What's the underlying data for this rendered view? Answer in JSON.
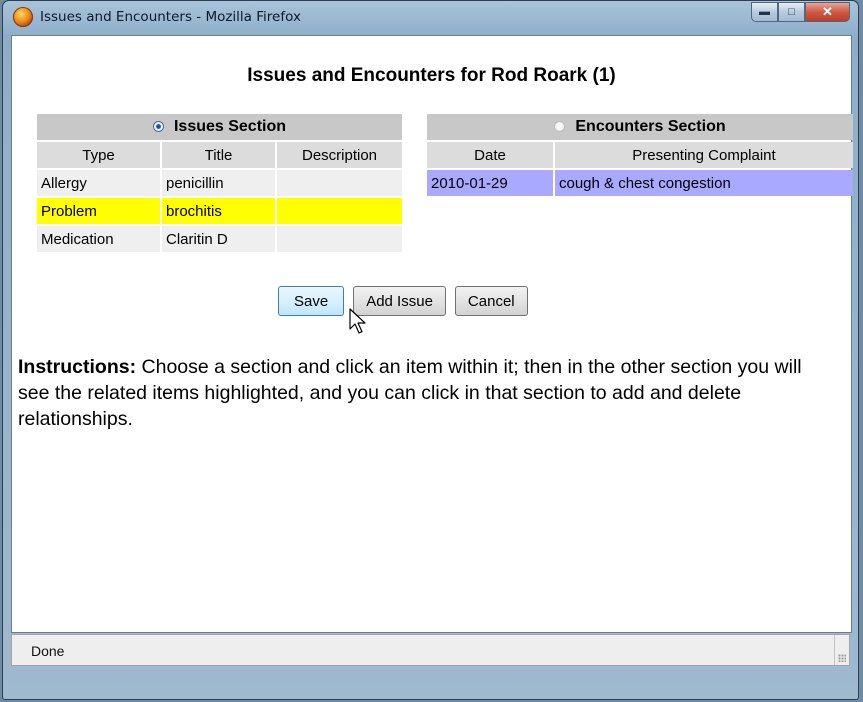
{
  "window": {
    "title": "Issues and Encounters - Mozilla Firefox",
    "controls": [
      "minimize",
      "maximize",
      "close"
    ]
  },
  "page": {
    "heading": "Issues and Encounters for Rod Roark (1)"
  },
  "issues": {
    "section_label": "Issues Section",
    "selected": true,
    "columns": [
      "Type",
      "Title",
      "Description"
    ],
    "rows": [
      {
        "type": "Allergy",
        "title": "penicillin",
        "description": "",
        "highlight": false
      },
      {
        "type": "Problem",
        "title": "brochitis",
        "description": "",
        "highlight": true
      },
      {
        "type": "Medication",
        "title": "Claritin D",
        "description": "",
        "highlight": false
      }
    ]
  },
  "encounters": {
    "section_label": "Encounters Section",
    "selected": false,
    "columns": [
      "Date",
      "Presenting Complaint"
    ],
    "rows": [
      {
        "date": "2010-01-29",
        "complaint": "cough & chest congestion",
        "highlight": true
      }
    ]
  },
  "buttons": {
    "save": "Save",
    "add_issue": "Add Issue",
    "cancel": "Cancel"
  },
  "instructions": {
    "label": "Instructions:",
    "text": " Choose a section and click an item within it; then in the other section you will see the related items highlighted, and you can click in that section to add and delete relationships."
  },
  "status": {
    "text": "Done"
  },
  "colors": {
    "highlight_issue": "#ffff00",
    "highlight_encounter": "#a9a9ff",
    "section_header": "#c8c8c8"
  }
}
